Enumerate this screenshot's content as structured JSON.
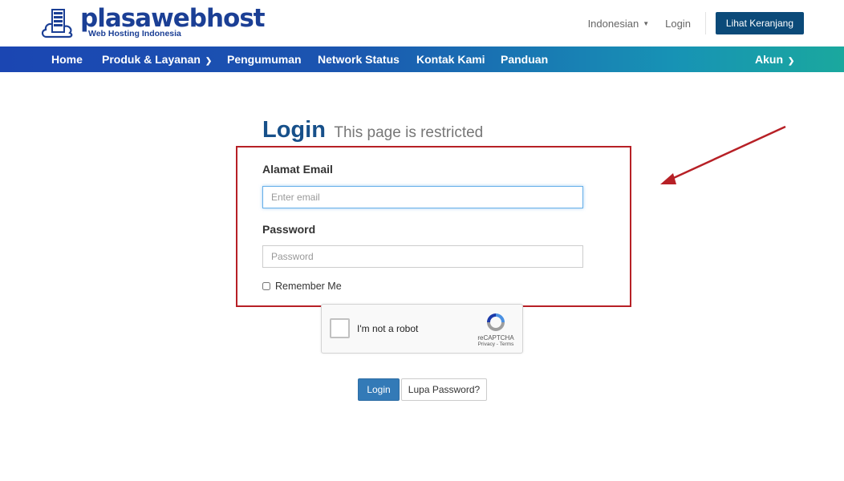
{
  "header": {
    "logo_name": "plasawebhost",
    "logo_tagline": "Web Hosting Indonesia",
    "language": "Indonesian",
    "login_link": "Login",
    "cart_button": "Lihat Keranjang"
  },
  "nav": {
    "items": [
      "Home",
      "Produk & Layanan",
      "Pengumuman",
      "Network Status",
      "Kontak Kami",
      "Panduan"
    ],
    "account": "Akun"
  },
  "page": {
    "title": "Login",
    "subtitle": "This page is restricted"
  },
  "form": {
    "email_label": "Alamat Email",
    "email_placeholder": "Enter email",
    "email_value": "",
    "password_label": "Password",
    "password_placeholder": "Password",
    "password_value": "",
    "remember_label": "Remember Me",
    "remember_checked": false
  },
  "captcha": {
    "text": "I'm not a robot",
    "brand": "reCAPTCHA",
    "links": "Privacy - Terms"
  },
  "buttons": {
    "login": "Login",
    "forgot": "Lupa Password?"
  },
  "colors": {
    "brand": "#1b3f95",
    "cart_button": "#0b4a79",
    "login_button": "#337ab7",
    "annotation": "#b72026"
  }
}
